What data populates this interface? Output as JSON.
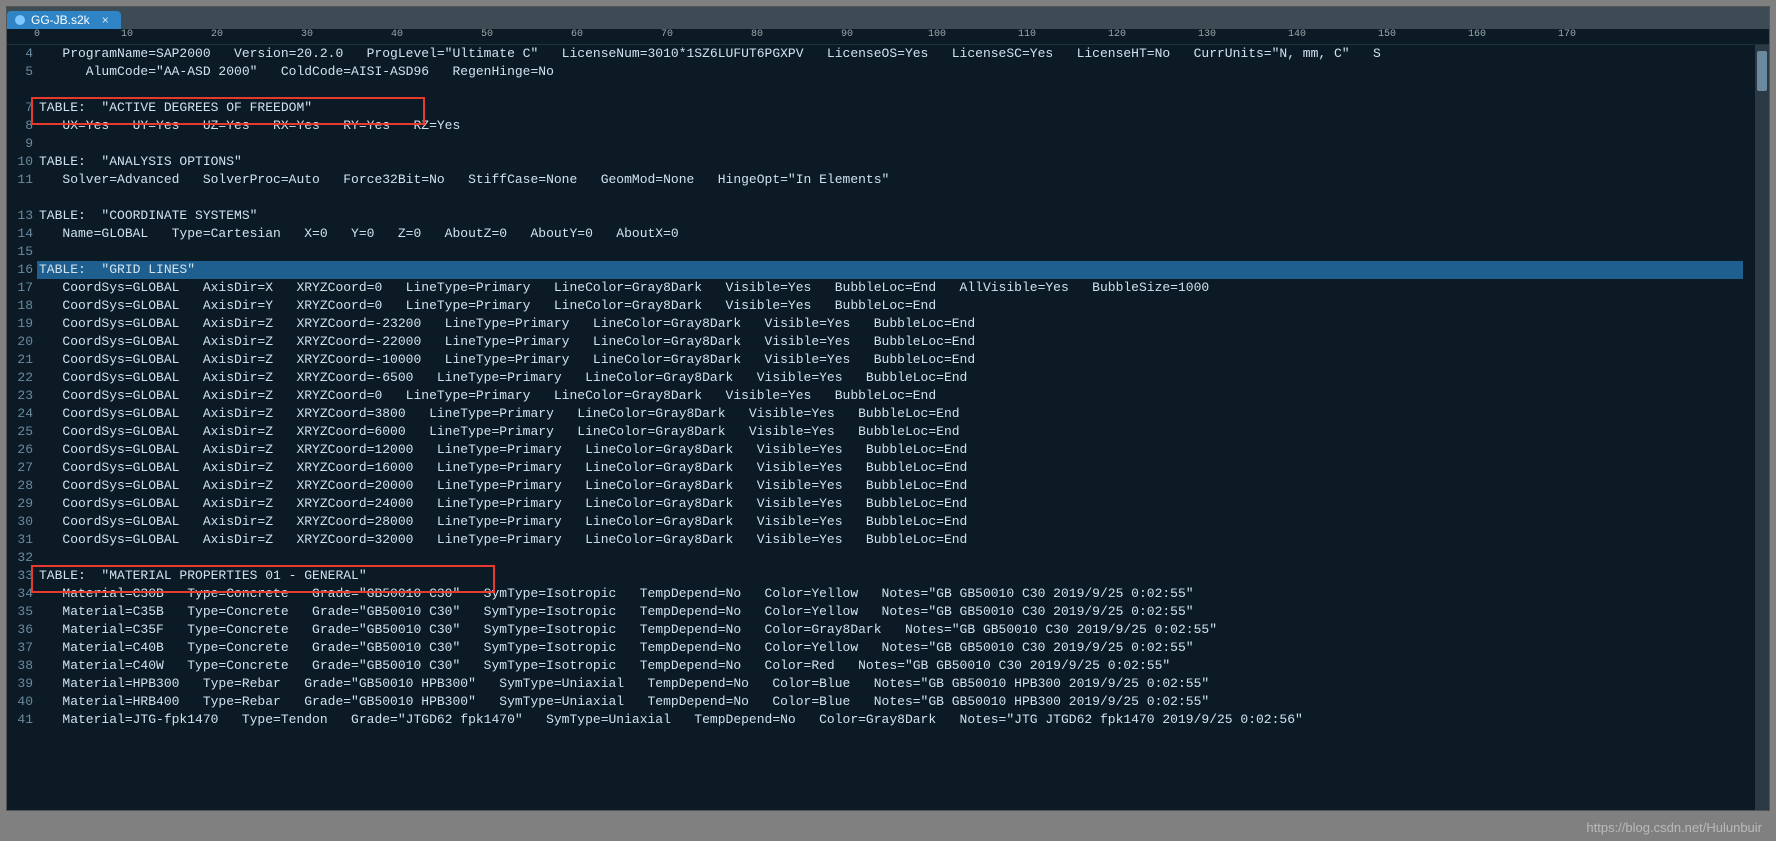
{
  "tab": {
    "title": "GG-JB.s2k",
    "close": "×"
  },
  "ruler_ticks": [
    0,
    10,
    20,
    30,
    40,
    50,
    60,
    70,
    80,
    90,
    100,
    110,
    120,
    130,
    140,
    150,
    160,
    170
  ],
  "gutter": [
    "4",
    "5",
    "",
    "7",
    "8",
    "9",
    "10",
    "11",
    "",
    "13",
    "14",
    "15",
    "16",
    "17",
    "18",
    "19",
    "20",
    "21",
    "22",
    "23",
    "24",
    "25",
    "26",
    "27",
    "28",
    "29",
    "30",
    "31",
    "32",
    "33",
    "34",
    "35",
    "36",
    "37",
    "38",
    "39",
    "40",
    "41"
  ],
  "lines": [
    "   ProgramName=SAP2000   Version=20.2.0   ProgLevel=\"Ultimate C\"   LicenseNum=3010*1SZ6LUFUT6PGXPV   LicenseOS=Yes   LicenseSC=Yes   LicenseHT=No   CurrUnits=\"N, mm, C\"   S",
    "      AlumCode=\"AA-ASD 2000\"   ColdCode=AISI-ASD96   RegenHinge=No",
    " ",
    "TABLE:  \"ACTIVE DEGREES OF FREEDOM\"",
    "   UX=Yes   UY=Yes   UZ=Yes   RX=Yes   RY=Yes   RZ=Yes",
    " ",
    "TABLE:  \"ANALYSIS OPTIONS\"",
    "   Solver=Advanced   SolverProc=Auto   Force32Bit=No   StiffCase=None   GeomMod=None   HingeOpt=\"In Elements\"",
    " ",
    "TABLE:  \"COORDINATE SYSTEMS\"",
    "   Name=GLOBAL   Type=Cartesian   X=0   Y=0   Z=0   AboutZ=0   AboutY=0   AboutX=0",
    " ",
    "TABLE:  \"GRID LINES\"",
    "   CoordSys=GLOBAL   AxisDir=X   XRYZCoord=0   LineType=Primary   LineColor=Gray8Dark   Visible=Yes   BubbleLoc=End   AllVisible=Yes   BubbleSize=1000",
    "   CoordSys=GLOBAL   AxisDir=Y   XRYZCoord=0   LineType=Primary   LineColor=Gray8Dark   Visible=Yes   BubbleLoc=End",
    "   CoordSys=GLOBAL   AxisDir=Z   XRYZCoord=-23200   LineType=Primary   LineColor=Gray8Dark   Visible=Yes   BubbleLoc=End",
    "   CoordSys=GLOBAL   AxisDir=Z   XRYZCoord=-22000   LineType=Primary   LineColor=Gray8Dark   Visible=Yes   BubbleLoc=End",
    "   CoordSys=GLOBAL   AxisDir=Z   XRYZCoord=-10000   LineType=Primary   LineColor=Gray8Dark   Visible=Yes   BubbleLoc=End",
    "   CoordSys=GLOBAL   AxisDir=Z   XRYZCoord=-6500   LineType=Primary   LineColor=Gray8Dark   Visible=Yes   BubbleLoc=End",
    "   CoordSys=GLOBAL   AxisDir=Z   XRYZCoord=0   LineType=Primary   LineColor=Gray8Dark   Visible=Yes   BubbleLoc=End",
    "   CoordSys=GLOBAL   AxisDir=Z   XRYZCoord=3800   LineType=Primary   LineColor=Gray8Dark   Visible=Yes   BubbleLoc=End",
    "   CoordSys=GLOBAL   AxisDir=Z   XRYZCoord=6000   LineType=Primary   LineColor=Gray8Dark   Visible=Yes   BubbleLoc=End",
    "   CoordSys=GLOBAL   AxisDir=Z   XRYZCoord=12000   LineType=Primary   LineColor=Gray8Dark   Visible=Yes   BubbleLoc=End",
    "   CoordSys=GLOBAL   AxisDir=Z   XRYZCoord=16000   LineType=Primary   LineColor=Gray8Dark   Visible=Yes   BubbleLoc=End",
    "   CoordSys=GLOBAL   AxisDir=Z   XRYZCoord=20000   LineType=Primary   LineColor=Gray8Dark   Visible=Yes   BubbleLoc=End",
    "   CoordSys=GLOBAL   AxisDir=Z   XRYZCoord=24000   LineType=Primary   LineColor=Gray8Dark   Visible=Yes   BubbleLoc=End",
    "   CoordSys=GLOBAL   AxisDir=Z   XRYZCoord=28000   LineType=Primary   LineColor=Gray8Dark   Visible=Yes   BubbleLoc=End",
    "   CoordSys=GLOBAL   AxisDir=Z   XRYZCoord=32000   LineType=Primary   LineColor=Gray8Dark   Visible=Yes   BubbleLoc=End",
    " ",
    "TABLE:  \"MATERIAL PROPERTIES 01 - GENERAL\"",
    "   Material=C30B   Type=Concrete   Grade=\"GB50010 C30\"   SymType=Isotropic   TempDepend=No   Color=Yellow   Notes=\"GB GB50010 C30 2019/9/25 0:02:55\"",
    "   Material=C35B   Type=Concrete   Grade=\"GB50010 C30\"   SymType=Isotropic   TempDepend=No   Color=Yellow   Notes=\"GB GB50010 C30 2019/9/25 0:02:55\"",
    "   Material=C35F   Type=Concrete   Grade=\"GB50010 C30\"   SymType=Isotropic   TempDepend=No   Color=Gray8Dark   Notes=\"GB GB50010 C30 2019/9/25 0:02:55\"",
    "   Material=C40B   Type=Concrete   Grade=\"GB50010 C30\"   SymType=Isotropic   TempDepend=No   Color=Yellow   Notes=\"GB GB50010 C30 2019/9/25 0:02:55\"",
    "   Material=C40W   Type=Concrete   Grade=\"GB50010 C30\"   SymType=Isotropic   TempDepend=No   Color=Red   Notes=\"GB GB50010 C30 2019/9/25 0:02:55\"",
    "   Material=HPB300   Type=Rebar   Grade=\"GB50010 HPB300\"   SymType=Uniaxial   TempDepend=No   Color=Blue   Notes=\"GB GB50010 HPB300 2019/9/25 0:02:55\"",
    "   Material=HRB400   Type=Rebar   Grade=\"GB50010 HPB300\"   SymType=Uniaxial   TempDepend=No   Color=Blue   Notes=\"GB GB50010 HPB300 2019/9/25 0:02:55\"",
    "   Material=JTG-fpk1470   Type=Tendon   Grade=\"JTGD62 fpk1470\"   SymType=Uniaxial   TempDepend=No   Color=Gray8Dark   Notes=\"JTG JTGD62 fpk1470 2019/9/25 0:02:56\""
  ],
  "highlight_line_index": 12,
  "watermark": "https://blog.csdn.net/Hulunbuir"
}
